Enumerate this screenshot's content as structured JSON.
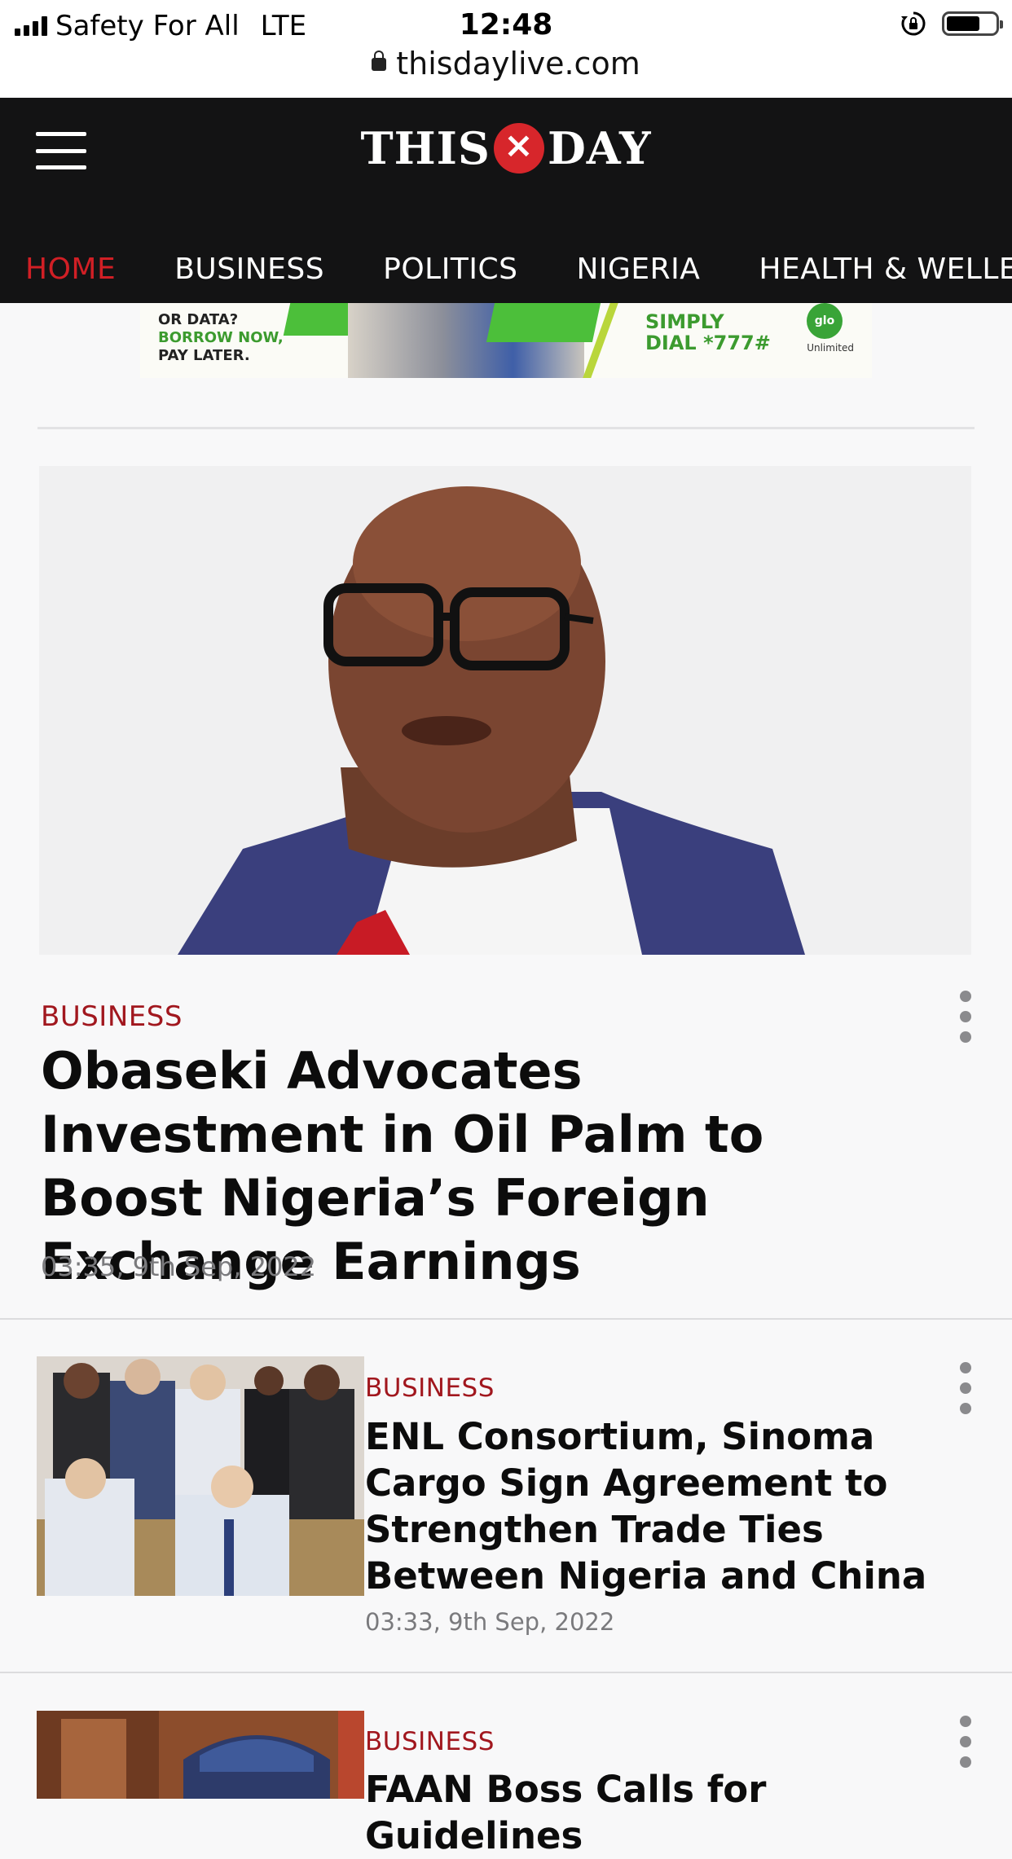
{
  "status_bar": {
    "carrier": "Safety For All",
    "network": "LTE",
    "time": "12:48",
    "url": "thisdaylive.com",
    "battery_level": 0.62
  },
  "header": {
    "logo_left": "THIS",
    "logo_right": "DAY",
    "nav": [
      {
        "label": "HOME",
        "active": true
      },
      {
        "label": "BUSINESS",
        "active": false
      },
      {
        "label": "POLITICS",
        "active": false
      },
      {
        "label": "NIGERIA",
        "active": false
      },
      {
        "label": "HEALTH & WELLE",
        "active": false
      }
    ],
    "accent_color": "#d11f25"
  },
  "ad": {
    "left_text_1": "OR DATA?",
    "left_text_2": "BORROW NOW,",
    "left_text_3": "PAY LATER.",
    "dial_text_1": "SIMPLY",
    "dial_text_2": "DIAL *777#",
    "brand": "glo",
    "brand_sub": "Unlimited"
  },
  "lead": {
    "category": "BUSINESS",
    "title": "Obaseki Advocates Investment in Oil Palm to Boost Nigeria’s Foreign Exchange Earnings",
    "time": "03:35, 9th Sep, 2022"
  },
  "articles": [
    {
      "category": "BUSINESS",
      "title": "ENL Consortium, Sinoma Cargo Sign Agreement to Strengthen Trade Ties Between Nigeria and China",
      "time": "03:33, 9th Sep, 2022"
    },
    {
      "category": "BUSINESS",
      "title": "FAAN Boss Calls for Guidelines",
      "time": ""
    }
  ]
}
